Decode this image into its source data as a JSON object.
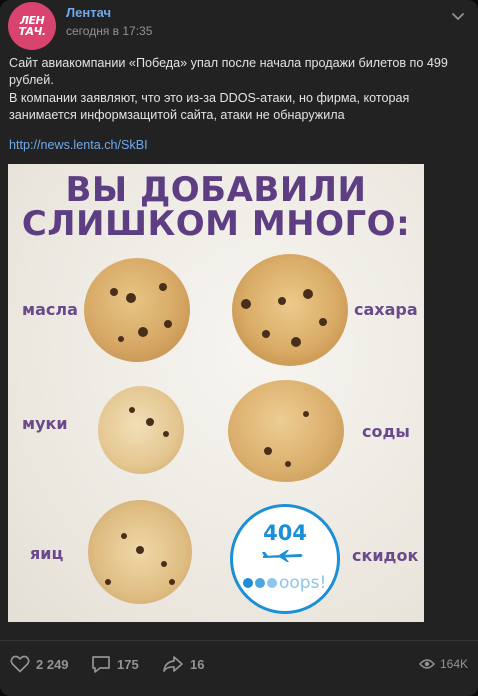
{
  "post": {
    "author": "Лентач",
    "avatar_lines": [
      "ЛЕН",
      "ТАЧ."
    ],
    "time": "сегодня в 17:35",
    "text1": "Сайт авиакомпании «Победа» упал после начала продажи билетов по 499 рублей.",
    "text2": "В компании заявляют, что это из-за DDOS-атаки, но фирма, которая занимается информзащитой сайта, атаки не обнаружила",
    "link": "http://news.lenta.ch/SkBI"
  },
  "image": {
    "headline_line1": "ВЫ ДОБАВИЛИ",
    "headline_line2": "СЛИШКОМ МНОГО:",
    "labels": [
      "масла",
      "сахара",
      "муки",
      "соды",
      "яиц",
      "скидок"
    ],
    "error_code": "404",
    "oops": "oops!"
  },
  "footer": {
    "likes": "2 249",
    "comments": "175",
    "shares": "16",
    "views": "164K"
  },
  "colors": {
    "background": "#222222",
    "accent": "#71aaeb",
    "brand": "#d9446e",
    "headline": "#5d3e82"
  },
  "icons": [
    "more-icon",
    "heart-icon",
    "comment-icon",
    "share-icon",
    "eye-icon",
    "plane-icon"
  ]
}
